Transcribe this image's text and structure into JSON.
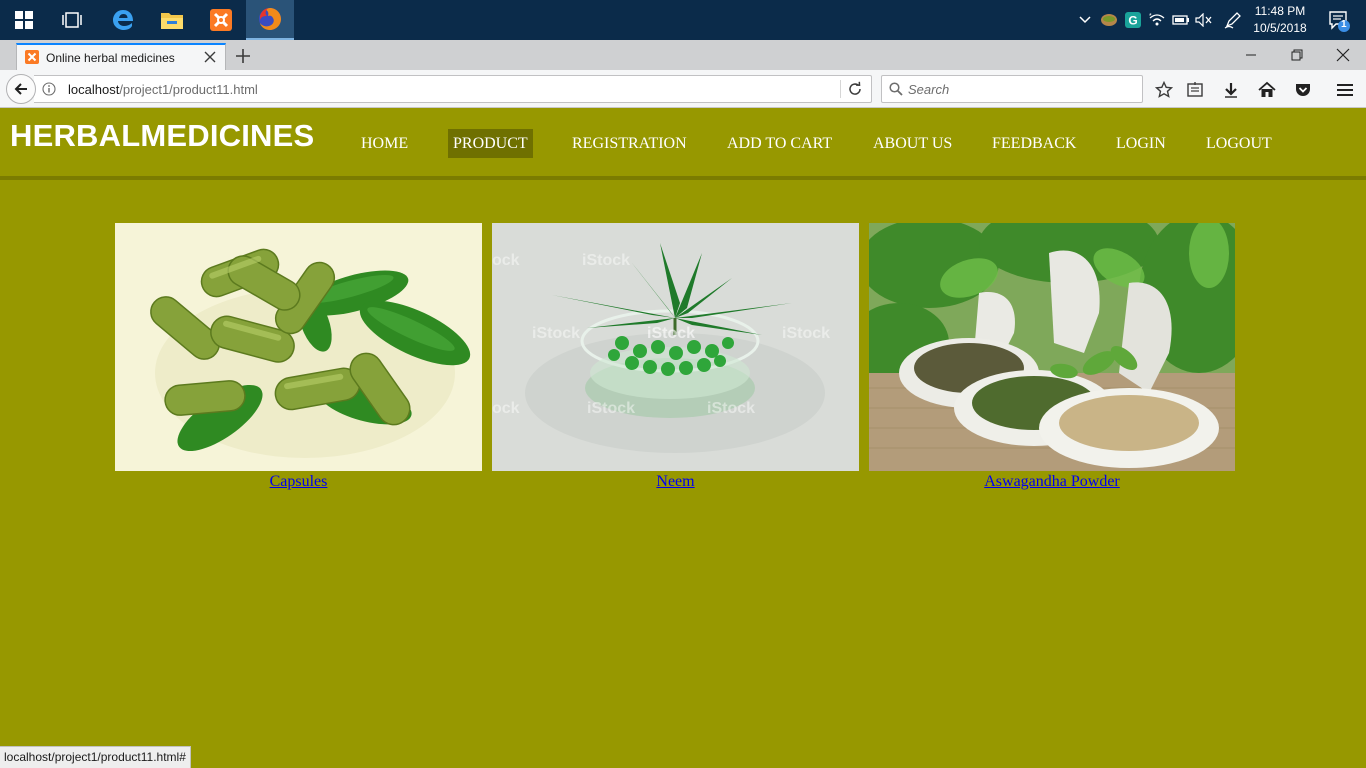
{
  "taskbar": {
    "apps": [
      {
        "name": "start-button"
      },
      {
        "name": "task-view"
      },
      {
        "name": "edge"
      },
      {
        "name": "file-explorer"
      },
      {
        "name": "xampp"
      },
      {
        "name": "firefox"
      }
    ],
    "clock_time": "11:48 PM",
    "clock_date": "10/5/2018",
    "notification_count": "1"
  },
  "browser": {
    "tab_title": "Online herbal medicines",
    "url_host": "localhost",
    "url_path": "/project1/product11.html",
    "search_placeholder": "Search",
    "status_url": "localhost/project1/product11.html#"
  },
  "site": {
    "title": "HERBALMEDICINES",
    "menu": [
      {
        "label": "HOME"
      },
      {
        "label": "PRODUCT",
        "active": true
      },
      {
        "label": "REGISTRATION"
      },
      {
        "label": "ADD TO CART"
      },
      {
        "label": "ABOUT US"
      },
      {
        "label": "FEEDBACK"
      },
      {
        "label": "LOGIN"
      },
      {
        "label": "LOGOUT"
      }
    ]
  },
  "products": [
    {
      "name": "Capsules"
    },
    {
      "name": "Neem",
      "watermark": "iStock"
    },
    {
      "name": "Aswagandha Powder"
    }
  ],
  "colors": {
    "page_bg": "#979800",
    "menu_active_bg": "#6f7000",
    "link": "#0000ee",
    "taskbar": "#0b2b4a"
  }
}
